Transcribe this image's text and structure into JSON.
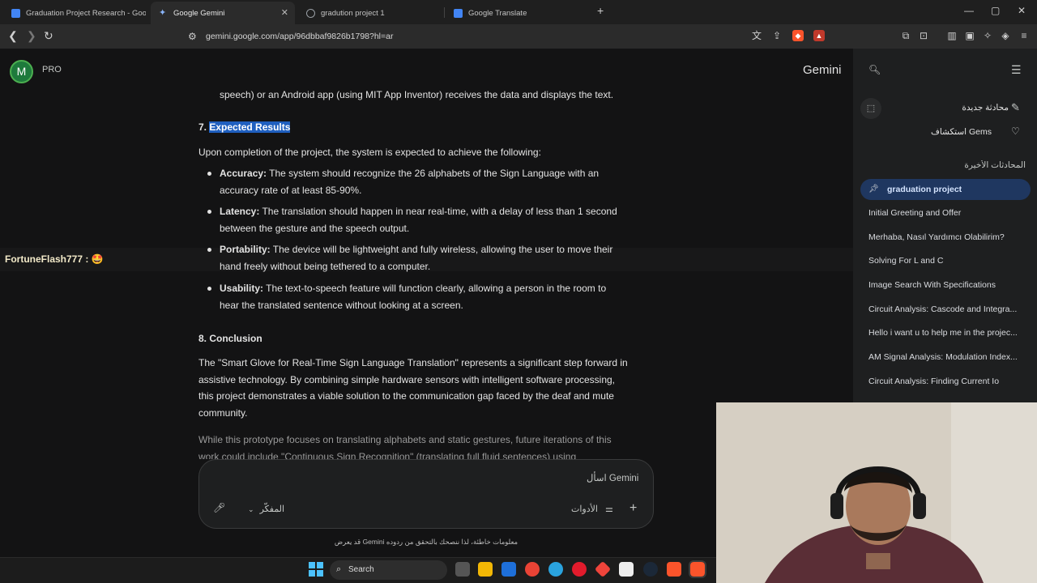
{
  "tabs": [
    {
      "title": "Graduation Project Research - Google D",
      "icon_color": "#4285f4"
    },
    {
      "title": "Google Gemini",
      "icon_color": "#8ab4f8"
    },
    {
      "title": "gradution project 1",
      "icon_color": "#9aa0a6"
    },
    {
      "title": "Google Translate",
      "icon_color": "#4285f4"
    }
  ],
  "address": {
    "url": "gemini.google.com/app/96dbbaf9826b1798?hl=ar"
  },
  "header": {
    "avatar_letter": "M",
    "plan": "PRO",
    "brand": "Gemini"
  },
  "sidebar": {
    "new_chat": "محادثة جديدة",
    "explore_gems": "استكشاف Gems",
    "recent_title": "المحادثات الأخيرة",
    "chats": [
      "graduation project",
      "Initial Greeting and Offer",
      "Merhaba, Nasıl Yardımcı Olabilirim?",
      "Solving For L and C",
      "Image Search With Specifications",
      "Circuit Analysis: Cascode and Integra...",
      "Hello i want u to help me in the projec...",
      "AM Signal Analysis: Modulation Index...",
      "Circuit Analysis: Finding Current Io"
    ]
  },
  "content": {
    "top_line": "speech) or an Android app (using MIT App Inventor) receives the data and displays the text.",
    "sec7_num": "7.",
    "sec7_title": "Expected Results",
    "sec7_intro": "Upon completion of the project, the system is expected to achieve the following:",
    "bullets": [
      {
        "label": "Accuracy:",
        "text": " The system should recognize the 26 alphabets of the Sign Language with an accuracy rate of at least 85-90%."
      },
      {
        "label": "Latency:",
        "text": " The translation should happen in near real-time, with a delay of less than 1 second between the gesture and the speech output."
      },
      {
        "label": "Portability:",
        "text": " The device will be lightweight and fully wireless, allowing the user to move their hand freely without being tethered to a computer."
      },
      {
        "label": "Usability:",
        "text": " The text-to-speech feature will function clearly, allowing a person in the room to hear the translated sentence without looking at a screen."
      }
    ],
    "sec8_title": "8. Conclusion",
    "sec8_p1": "The \"Smart Glove for Real-Time Sign Language Translation\" represents a significant step forward in assistive technology. By combining simple hardware sensors with intelligent software processing, this project demonstrates a viable solution to the communication gap faced by the deaf and mute community.",
    "sec8_p2": "While this prototype focuses on translating alphabets and static gestures, future iterations of this work could include \"Continuous Sign Recognition\" (translating full fluid sentences) using"
  },
  "overlay": {
    "text": "FortuneFlash777 : 🤩"
  },
  "input": {
    "placeholder": "اسأل Gemini",
    "tools": "الأدوات",
    "model": "المفكّر",
    "disclaimer": "قد يعرض Gemini معلومات خاطئة، لذا ننصحك بالتحقق من ردوده"
  },
  "taskbar": {
    "search": "Search"
  }
}
